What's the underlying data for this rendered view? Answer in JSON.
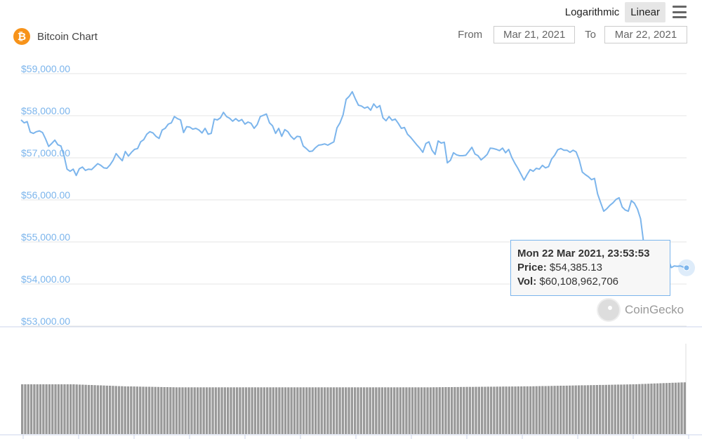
{
  "header": {
    "scale_options": [
      "Logarithmic",
      "Linear"
    ],
    "active_scale": "Linear",
    "title": "Bitcoin Chart",
    "coin_symbol": "₿",
    "from_label": "From",
    "from_value": "Mar 21, 2021",
    "to_label": "To",
    "to_value": "Mar 22, 2021"
  },
  "tooltip": {
    "date": "Mon 22 Mar 2021, 23:53:53",
    "price_label": "Price:",
    "price_value": "$54,385.13",
    "vol_label": "Vol:",
    "vol_value": "$60,108,962,706"
  },
  "watermark": "CoinGecko",
  "colors": {
    "line": "#7cb5ec",
    "axis_text": "#7cb5ec",
    "volume": "#999999",
    "grid": "#e6e6e6",
    "btc": "#f7931a"
  },
  "chart_data": {
    "type": "line",
    "title": "Bitcoin Chart",
    "x_range": [
      "Mar 21, 2021",
      "Mar 22, 2021"
    ],
    "yticks": [
      "$59,000.00",
      "$58,000.00",
      "$57,000.00",
      "$56,000.00",
      "$55,000.00",
      "$54,000.00",
      "$53,000.00"
    ],
    "ylim": [
      53000,
      59000
    ],
    "grid": true,
    "series": [
      {
        "values": [
          57900,
          57830,
          57860,
          57610,
          57580,
          57620,
          57640,
          57600,
          57450,
          57270,
          57340,
          57420,
          57310,
          57280,
          57050,
          56730,
          56680,
          56730,
          56580,
          56740,
          56780,
          56700,
          56730,
          56720,
          56790,
          56860,
          56820,
          56760,
          56750,
          56830,
          56940,
          57100,
          57010,
          56930,
          57150,
          57040,
          57130,
          57200,
          57220,
          57380,
          57430,
          57560,
          57620,
          57590,
          57510,
          57460,
          57660,
          57700,
          57800,
          57830,
          57980,
          57930,
          57900,
          57600,
          57740,
          57730,
          57680,
          57700,
          57660,
          57590,
          57700,
          57560,
          57580,
          57920,
          57900,
          57950,
          58080,
          57980,
          57940,
          57870,
          57930,
          57870,
          57910,
          57800,
          57850,
          57820,
          57700,
          57790,
          57980,
          58010,
          58040,
          57830,
          57760,
          57580,
          57700,
          57510,
          57670,
          57620,
          57510,
          57440,
          57510,
          57500,
          57280,
          57220,
          57150,
          57160,
          57240,
          57300,
          57310,
          57330,
          57300,
          57340,
          57380,
          57710,
          57830,
          58020,
          58390,
          58460,
          58570,
          58400,
          58250,
          58230,
          58180,
          58210,
          58130,
          58280,
          58190,
          58240,
          57950,
          57880,
          57980,
          57890,
          57920,
          57820,
          57700,
          57720,
          57560,
          57490,
          57400,
          57310,
          57230,
          57130,
          57340,
          57380,
          57180,
          57080,
          57400,
          57350,
          57370,
          56880,
          56940,
          57120,
          57070,
          57050,
          57050,
          57060,
          57150,
          57250,
          57090,
          57050,
          56950,
          57010,
          57080,
          57230,
          57220,
          57200,
          57170,
          57230,
          57120,
          57200,
          57010,
          56870,
          56750,
          56610,
          56470,
          56600,
          56720,
          56680,
          56750,
          56730,
          56820,
          56760,
          56790,
          56970,
          57060,
          57190,
          57220,
          57180,
          57180,
          57130,
          57180,
          57140,
          56950,
          56660,
          56600,
          56550,
          56480,
          56510,
          56140,
          55930,
          55730,
          55790,
          55870,
          55930,
          56010,
          56050,
          55830,
          55760,
          55730,
          55980,
          55920,
          55780,
          55550,
          54990,
          54730,
          54380,
          54600,
          54720,
          54880,
          54320,
          54480,
          54600,
          54390,
          54430,
          54420,
          54430,
          54400,
          54385.13
        ]
      }
    ],
    "volume_bars": {
      "count": 220,
      "profile_relative": [
        1.0,
        1.0,
        0.96,
        0.94,
        0.94,
        0.94,
        0.94,
        0.94,
        0.94,
        0.95,
        0.96,
        0.98,
        1.0,
        1.04
      ]
    }
  }
}
